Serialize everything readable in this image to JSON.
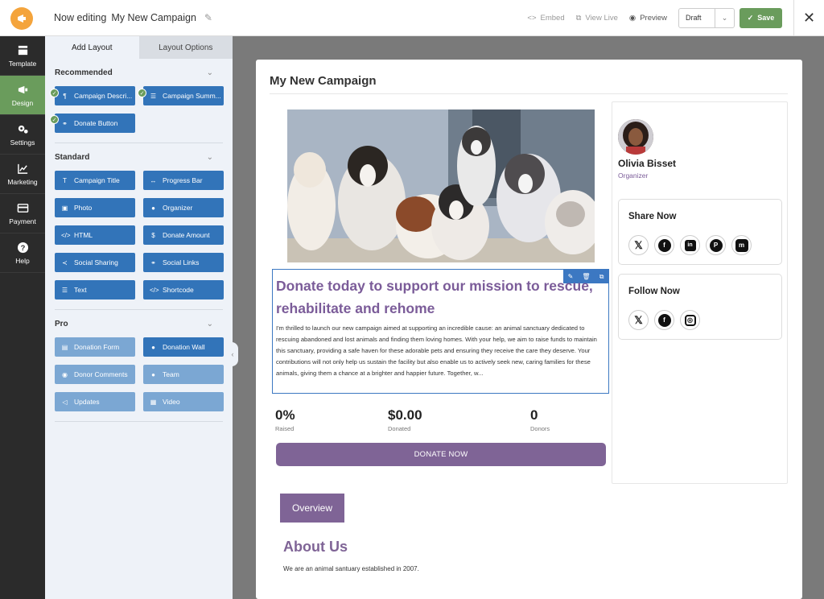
{
  "header": {
    "editing_label": "Now editing",
    "campaign_name": "My New Campaign",
    "embed": "Embed",
    "view_live": "View Live",
    "preview": "Preview",
    "status": "Draft",
    "save": "Save"
  },
  "nav": [
    {
      "label": "Template",
      "icon": "template-icon"
    },
    {
      "label": "Design",
      "icon": "megaphone-icon",
      "active": true
    },
    {
      "label": "Settings",
      "icon": "gears-icon"
    },
    {
      "label": "Marketing",
      "icon": "chart-icon"
    },
    {
      "label": "Payment",
      "icon": "card-icon"
    },
    {
      "label": "Help",
      "icon": "help-icon"
    }
  ],
  "panel": {
    "tabs": [
      "Add Layout",
      "Layout Options"
    ],
    "recommended": {
      "title": "Recommended",
      "items": [
        {
          "label": "Campaign Descri...",
          "icon": "¶"
        },
        {
          "label": "Campaign Summ...",
          "icon": "☰"
        },
        {
          "label": "Donate Button",
          "icon": "⚭"
        }
      ]
    },
    "standard": {
      "title": "Standard",
      "items": [
        {
          "label": "Campaign Title",
          "icon": "T"
        },
        {
          "label": "Progress Bar",
          "icon": "↔"
        },
        {
          "label": "Photo",
          "icon": "▣"
        },
        {
          "label": "Organizer",
          "icon": "●"
        },
        {
          "label": "HTML",
          "icon": "</>"
        },
        {
          "label": "Donate Amount",
          "icon": "$"
        },
        {
          "label": "Social Sharing",
          "icon": "≺"
        },
        {
          "label": "Social Links",
          "icon": "⚭"
        },
        {
          "label": "Text",
          "icon": "☰"
        },
        {
          "label": "Shortcode",
          "icon": "</>"
        }
      ]
    },
    "pro": {
      "title": "Pro",
      "items": [
        {
          "label": "Donation Form",
          "icon": "▤",
          "pale": true
        },
        {
          "label": "Donation Wall",
          "icon": "●",
          "pale": false
        },
        {
          "label": "Donor Comments",
          "icon": "◉",
          "pale": true
        },
        {
          "label": "Team",
          "icon": "●●",
          "pale": true
        },
        {
          "label": "Updates",
          "icon": "◁",
          "pale": true
        },
        {
          "label": "Video",
          "icon": "▦",
          "pale": true
        }
      ]
    }
  },
  "campaign": {
    "title": "My New Campaign",
    "headline": "Donate today to support our mission to rescue, rehabilitate and rehome",
    "description": "I'm thrilled to launch our new campaign aimed at supporting an incredible cause: an animal sanctuary dedicated to rescuing abandoned and lost animals and finding them loving homes. With your help, we aim to raise funds to maintain this sanctuary, providing a safe haven for these adorable pets and ensuring they receive the care they deserve. Your contributions will not only help us sustain the facility but also enable us to actively seek new, caring families for these animals, giving them a chance at a brighter and happier future. Together, w...",
    "stats": [
      {
        "value": "0%",
        "label": "Raised"
      },
      {
        "value": "$0.00",
        "label": "Donated"
      },
      {
        "value": "0",
        "label": "Donors"
      }
    ],
    "donate_label": "DONATE NOW",
    "overview_tab": "Overview",
    "about_heading": "About Us",
    "about_text": "We are an animal santuary established in 2007."
  },
  "organizer": {
    "name": "Olivia Bisset",
    "role": "Organizer"
  },
  "share": {
    "title": "Share Now",
    "icons": [
      "x-icon",
      "facebook-icon",
      "linkedin-icon",
      "pinterest-icon",
      "mastodon-icon"
    ]
  },
  "follow": {
    "title": "Follow Now",
    "icons": [
      "x-icon",
      "facebook-icon",
      "instagram-icon"
    ]
  },
  "colors": {
    "accent_green": "#6a9c5c",
    "layout_button_blue": "#3274b9",
    "brand_purple": "#7f6496",
    "logo_orange": "#f4a43c"
  }
}
